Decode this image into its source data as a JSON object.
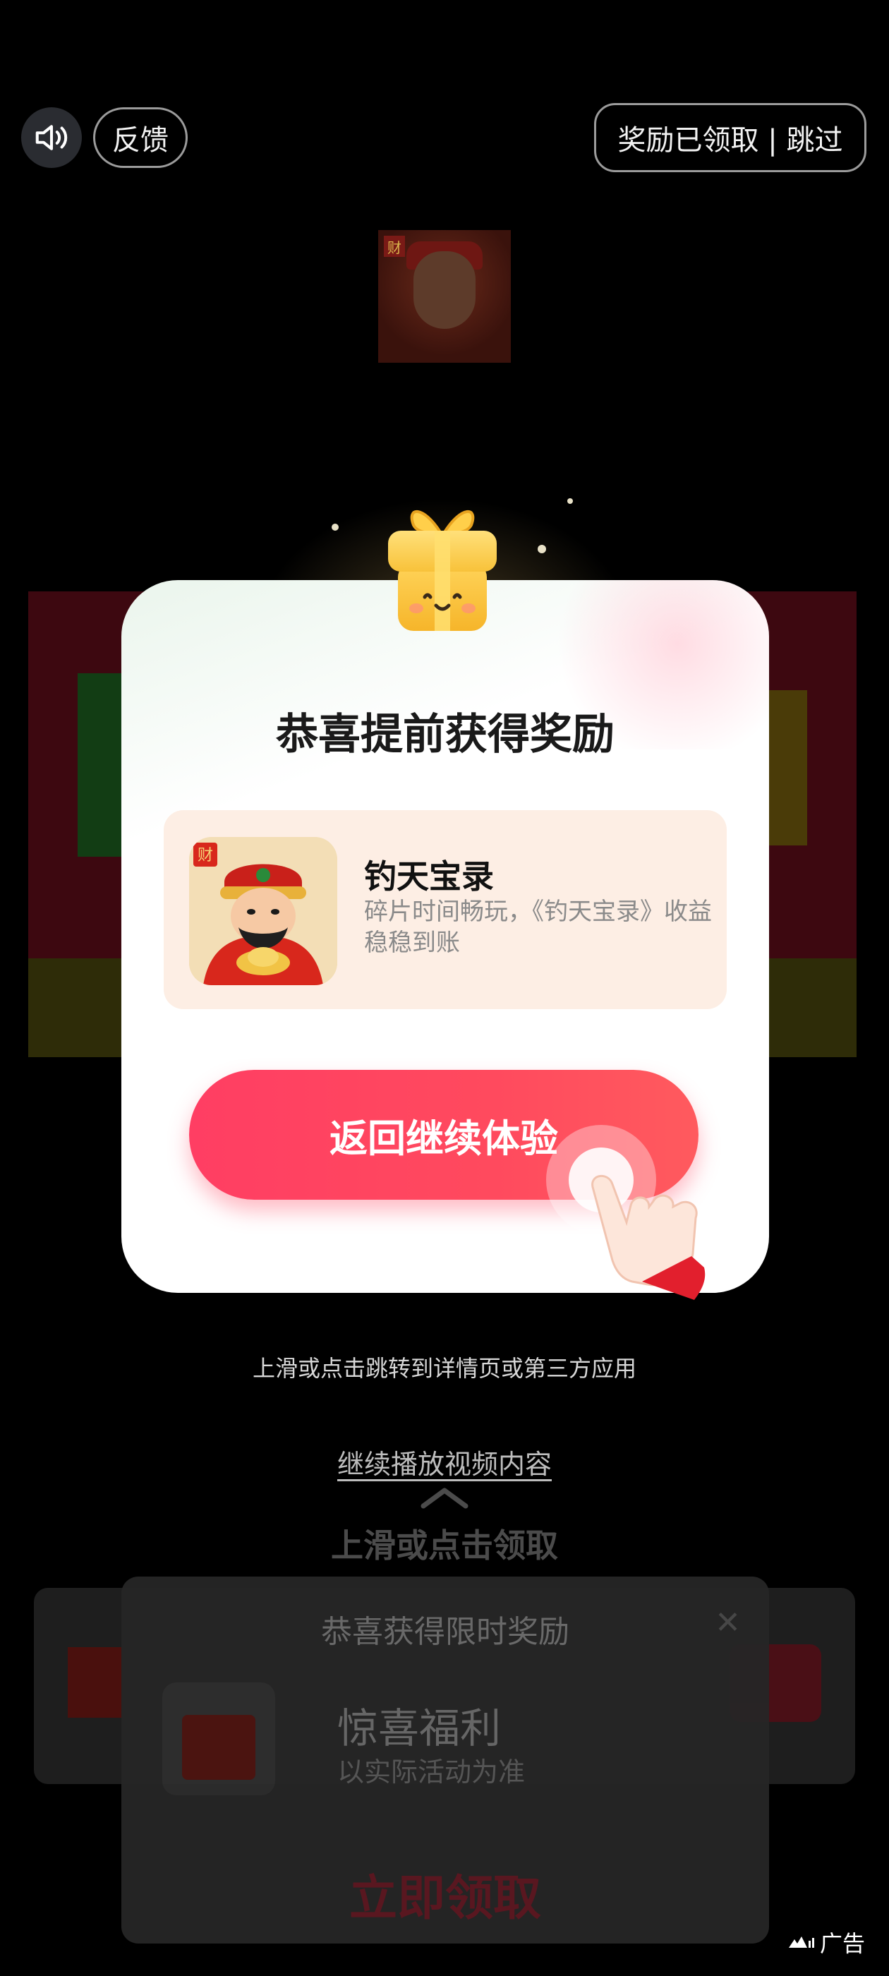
{
  "top_bar": {
    "sound_icon": "speaker-icon",
    "feedback_label": "反馈",
    "skip_label": "奖励已领取 | 跳过"
  },
  "modal": {
    "title": "恭喜提前获得奖励",
    "app": {
      "name": "钓天宝录",
      "icon": "god-of-wealth-icon",
      "icon_badge": "财",
      "description": "碎片时间畅玩，《钓天宝录》收益稳稳到账"
    },
    "button_label": "返回继续体验"
  },
  "hint": {
    "small_text": "上滑或点击跳转到详情页或第三方应用",
    "continue_link": "继续播放视频内容",
    "swipe_text": "上滑或点击领取"
  },
  "background_popup": {
    "title": "恭喜获得限时奖励",
    "close_icon": "close-icon",
    "item_name": "惊喜福利",
    "item_subtitle": "以实际活动为准",
    "cta_label": "立即领取"
  },
  "ad_badge": {
    "label": "广告"
  },
  "colors": {
    "accent": "#ff4560",
    "card_bg": "#fdeee4",
    "background": "#000000"
  }
}
